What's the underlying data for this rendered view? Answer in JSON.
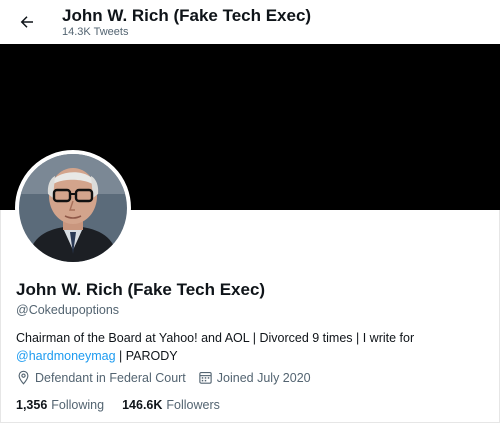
{
  "header": {
    "title": "John W. Rich (Fake Tech Exec)",
    "tweet_count": "14.3K Tweets"
  },
  "profile": {
    "display_name": "John W. Rich (Fake Tech Exec)",
    "handle": "@Cokedupoptions",
    "bio_text": "Chairman of the Board at Yahoo! and AOL  | Divorced 9 times | I write for ",
    "bio_mention": "@hardmoneymag",
    "bio_suffix": " | PARODY",
    "location": "Defendant in Federal Court",
    "joined": "Joined July 2020",
    "following_count": "1,356",
    "following_label": "Following",
    "followers_count": "146.6K",
    "followers_label": "Followers"
  },
  "icons": {
    "back": "arrow-left-icon",
    "location": "location-pin-icon",
    "joined": "calendar-icon"
  },
  "colors": {
    "banner": "#000000",
    "link": "#1d9bf0",
    "secondary_text": "#536471"
  }
}
